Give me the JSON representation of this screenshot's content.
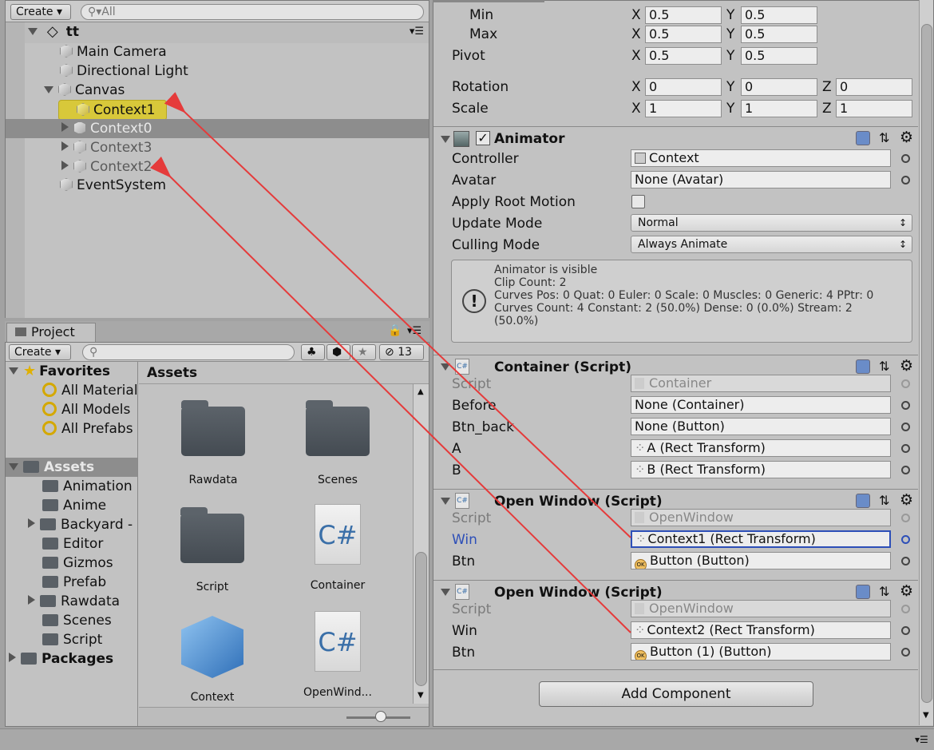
{
  "hierarchy": {
    "create_label": "Create",
    "search_placeholder": "All",
    "scene_name": "tt",
    "items": [
      {
        "label": "Main Camera"
      },
      {
        "label": "Directional Light"
      },
      {
        "label": "Canvas"
      },
      {
        "label": "Context1"
      },
      {
        "label": "Context0"
      },
      {
        "label": "Context3"
      },
      {
        "label": "Context2"
      },
      {
        "label": "EventSystem"
      }
    ]
  },
  "project": {
    "tab_label": "Project",
    "create_label": "Create",
    "hidden_count": "13",
    "favorites_label": "Favorites",
    "favorites": [
      "All Material",
      "All Models",
      "All Prefabs"
    ],
    "assets_label": "Assets",
    "asset_folders": [
      "Animation",
      "Anime",
      "Backyard -",
      "Editor",
      "Gizmos",
      "Prefab",
      "Rawdata",
      "Scenes",
      "Script"
    ],
    "packages_label": "Packages",
    "breadcrumb": "Assets",
    "grid": [
      {
        "label": "Rawdata",
        "icon": "folder-icon"
      },
      {
        "label": "Scenes",
        "icon": "folder-icon"
      },
      {
        "label": "Script",
        "icon": "folder-icon"
      },
      {
        "label": "Container",
        "icon": "csharp-file-icon"
      },
      {
        "label": "Context",
        "icon": "prefab-cube-icon"
      },
      {
        "label": "OpenWind...",
        "icon": "csharp-file-icon"
      }
    ],
    "csharp_glyph": "C#"
  },
  "inspector": {
    "anchors": {
      "min_label": "Min",
      "min_x": "0.5",
      "min_y": "0.5",
      "max_label": "Max",
      "max_x": "0.5",
      "max_y": "0.5"
    },
    "pivot": {
      "label": "Pivot",
      "x": "0.5",
      "y": "0.5"
    },
    "rotation": {
      "label": "Rotation",
      "x": "0",
      "y": "0",
      "z": "0"
    },
    "scale": {
      "label": "Scale",
      "x": "1",
      "y": "1",
      "z": "1"
    },
    "axis": {
      "x": "X",
      "y": "Y",
      "z": "Z"
    },
    "animator": {
      "title": "Animator",
      "controller_label": "Controller",
      "controller_value": "Context",
      "avatar_label": "Avatar",
      "avatar_value": "None (Avatar)",
      "root_motion_label": "Apply Root Motion",
      "update_label": "Update Mode",
      "update_value": "Normal",
      "culling_label": "Culling Mode",
      "culling_value": "Always Animate",
      "info_line1": "Animator is visible",
      "info_line2": "Clip Count: 2",
      "info_line3": "Curves Pos: 0 Quat: 0 Euler: 0 Scale: 0 Muscles: 0 Generic: 4 PPtr: 0",
      "info_line4": "Curves Count: 4 Constant: 2 (50.0%) Dense: 0 (0.0%) Stream: 2",
      "info_line5": "(50.0%)"
    },
    "container": {
      "title": "Container (Script)",
      "script_label": "Script",
      "script_value": "Container",
      "before_label": "Before",
      "before_value": "None (Container)",
      "btnback_label": "Btn_back",
      "btnback_value": "None (Button)",
      "a_label": "A",
      "a_value": "A (Rect Transform)",
      "b_label": "B",
      "b_value": "B (Rect Transform)"
    },
    "open_window_1": {
      "title": "Open Window (Script)",
      "script_label": "Script",
      "script_value": "OpenWindow",
      "win_label": "Win",
      "win_value": "Context1 (Rect Transform)",
      "btn_label": "Btn",
      "btn_value": "Button (Button)"
    },
    "open_window_2": {
      "title": "Open Window (Script)",
      "script_label": "Script",
      "script_value": "OpenWindow",
      "win_label": "Win",
      "win_value": "Context2 (Rect Transform)",
      "btn_label": "Btn",
      "btn_value": "Button (1) (Button)"
    },
    "add_component_label": "Add Component"
  },
  "colors": {
    "selection_highlight": "#d8c83a",
    "row_selected": "#8d8d8d",
    "annotation_arrow": "#e53b3b",
    "focus_blue": "#2d4fb8"
  }
}
